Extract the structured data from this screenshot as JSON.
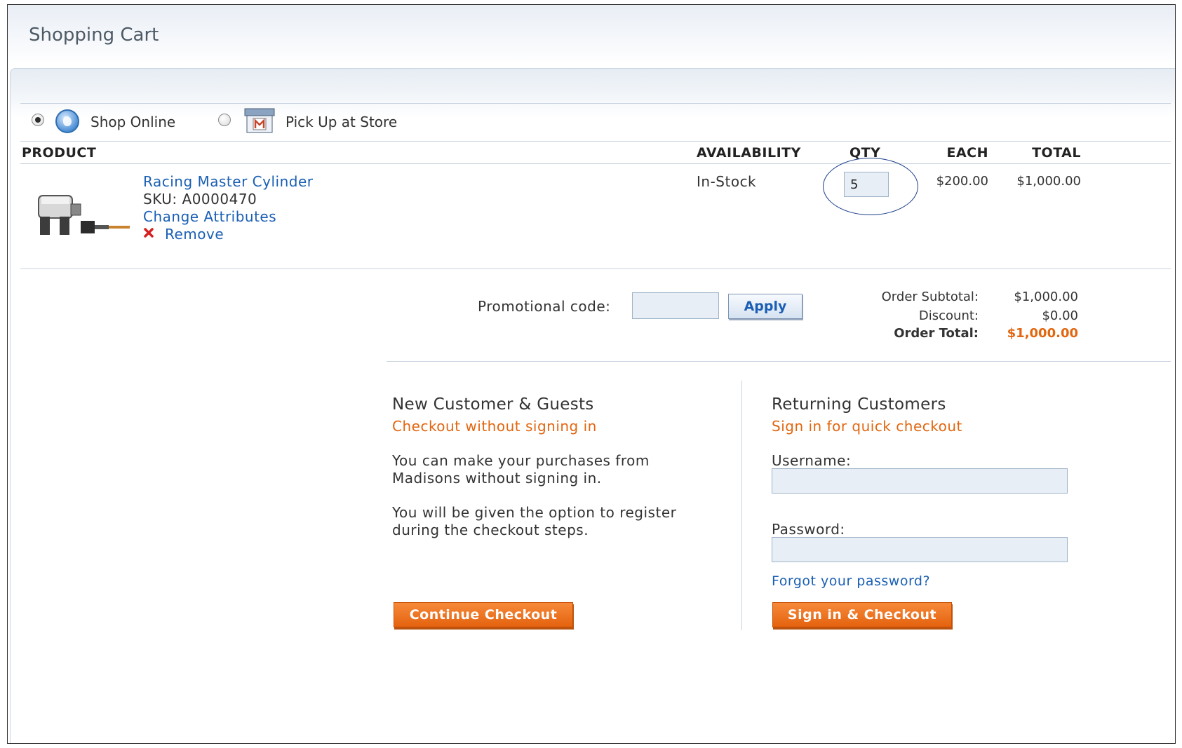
{
  "page": {
    "title": "Shopping Cart"
  },
  "delivery": {
    "options": [
      {
        "label": "Shop Online",
        "icon": "globe-icon",
        "selected": true
      },
      {
        "label": "Pick Up at Store",
        "icon": "store-icon",
        "selected": false
      }
    ]
  },
  "table": {
    "columns": {
      "product": "PRODUCT",
      "availability": "AVAILABILITY",
      "qty": "QTY",
      "each": "EACH",
      "total": "TOTAL"
    },
    "rows": [
      {
        "name": "Racing Master Cylinder",
        "sku": "SKU: A0000470",
        "change_attributes": "Change Attributes",
        "remove": "Remove",
        "availability": "In-Stock",
        "qty": "5",
        "each": "$200.00",
        "total": "$1,000.00"
      }
    ]
  },
  "promo": {
    "label": "Promotional code:",
    "value": "",
    "apply_label": "Apply"
  },
  "summary": {
    "subtotal_label": "Order Subtotal:",
    "subtotal_value": "$1,000.00",
    "discount_label": "Discount:",
    "discount_value": "$0.00",
    "total_label": "Order Total:",
    "total_value": "$1,000.00"
  },
  "guest": {
    "heading": "New Customer & Guests",
    "subheading": "Checkout without signing in",
    "para1_line1": "You can make your purchases from",
    "para1_line2": "Madisons without signing in.",
    "para2_line1": "You will be given the option to register",
    "para2_line2": "during the checkout steps.",
    "button": "Continue Checkout"
  },
  "returning": {
    "heading": "Returning Customers",
    "subheading": "Sign in for quick checkout",
    "username_label": "Username:",
    "username_value": "",
    "password_label": "Password:",
    "password_value": "",
    "forgot": "Forgot your password?",
    "button": "Sign in & Checkout"
  },
  "colors": {
    "accent_orange": "#e2660f",
    "link_blue": "#1a5fb4",
    "qty_ring": "#1d3f8a"
  }
}
